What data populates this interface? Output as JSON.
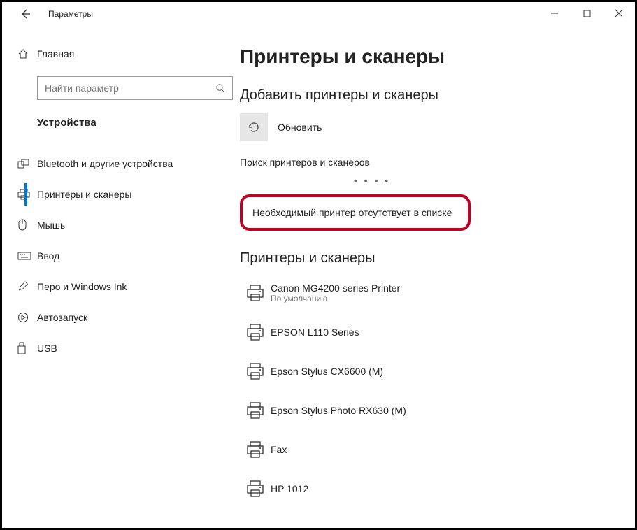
{
  "titlebar": {
    "title": "Параметры"
  },
  "sidebar": {
    "home": "Главная",
    "search_placeholder": "Найти параметр",
    "category": "Устройства",
    "items": [
      {
        "label": "Bluetooth и другие устройства"
      },
      {
        "label": "Принтеры и сканеры"
      },
      {
        "label": "Мышь"
      },
      {
        "label": "Ввод"
      },
      {
        "label": "Перо и Windows Ink"
      },
      {
        "label": "Автозапуск"
      },
      {
        "label": "USB"
      }
    ]
  },
  "content": {
    "page_title": "Принтеры и сканеры",
    "add_section": "Добавить принтеры и сканеры",
    "refresh_label": "Обновить",
    "search_status": "Поиск принтеров и сканеров",
    "missing_printer": "Необходимый принтер отсутствует в списке",
    "list_section": "Принтеры и сканеры",
    "printers": [
      {
        "name": "Canon MG4200 series Printer",
        "sub": "По умолчанию"
      },
      {
        "name": "EPSON L110 Series",
        "sub": ""
      },
      {
        "name": "Epson Stylus CX6600 (M)",
        "sub": ""
      },
      {
        "name": "Epson Stylus Photo RX630 (M)",
        "sub": ""
      },
      {
        "name": "Fax",
        "sub": ""
      },
      {
        "name": "HP 1012",
        "sub": ""
      }
    ]
  }
}
